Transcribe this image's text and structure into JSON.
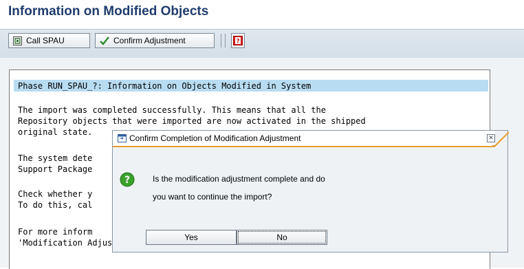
{
  "page": {
    "title": "Information on Modified Objects"
  },
  "toolbar": {
    "call_spau_label": "Call SPAU",
    "confirm_label": "Confirm Adjustment",
    "call_spau_icon": "execute-icon",
    "confirm_icon": "checkmark-icon",
    "help_icon": "help-icon"
  },
  "log": {
    "phase_line": "Phase RUN_SPAU_?: Information on Objects Modified in System",
    "lines": [
      "The import was completed successfully. This means that all the",
      "Repository objects that were imported are now activated in the shipped",
      "original state.",
      "The system dete",
      "Support Package",
      "Check whether y",
      "To do this, cal",
      "For more inform",
      "'Modification Adjustment Help'."
    ]
  },
  "dialog": {
    "title": "Confirm Completion of Modification Adjustment",
    "message_line1": "Is the modification adjustment complete and do",
    "message_line2": "you want to continue the import?",
    "yes_label": "Yes",
    "no_label": "No",
    "icon": "question-icon",
    "accent_color": "#e89b2f"
  },
  "colors": {
    "title": "#1f3c6e",
    "phase_highlight": "#b8dcf2",
    "question_icon": "#3aa12a"
  }
}
